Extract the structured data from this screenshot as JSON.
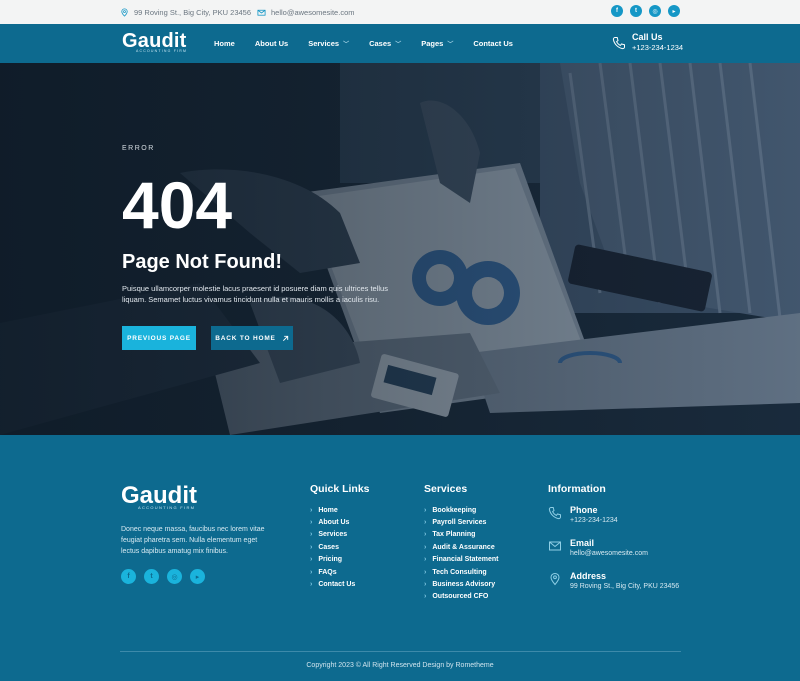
{
  "topbar": {
    "address": "99 Roving St., Big City, PKU 23456",
    "email": "hello@awesomesite.com",
    "social": [
      "facebook-icon",
      "twitter-icon",
      "instagram-icon",
      "youtube-icon"
    ]
  },
  "brand": {
    "name": "Gaudit",
    "tagline": "ACCOUNTING FIRM"
  },
  "nav": {
    "items": [
      {
        "label": "Home",
        "dropdown": false
      },
      {
        "label": "About Us",
        "dropdown": false
      },
      {
        "label": "Services",
        "dropdown": true
      },
      {
        "label": "Cases",
        "dropdown": true
      },
      {
        "label": "Pages",
        "dropdown": true
      },
      {
        "label": "Contact Us",
        "dropdown": false
      }
    ],
    "call_title": "Call Us",
    "call_number": "+123-234-1234"
  },
  "hero": {
    "eyebrow": "ERROR",
    "code": "404",
    "title": "Page Not Found!",
    "description": "Puisque ullamcorper molestie lacus praesent id posuere diam quis ultrices tellus liquam. Semamet luctus vivamus tincidunt nulla et mauris mollis a iaculis risu.",
    "btn_prev": "PREVIOUS PAGE",
    "btn_home": "BACK TO HOME"
  },
  "footer": {
    "about": "Donec neque massa, faucibus nec lorem vitae feugiat pharetra sem. Nulla elementum eget lectus dapibus amatug mix finibus.",
    "quick_links_title": "Quick Links",
    "quick_links": [
      "Home",
      "About Us",
      "Services",
      "Cases",
      "Pricing",
      "FAQs",
      "Contact Us"
    ],
    "services_title": "Services",
    "services": [
      "Bookkeeping",
      "Payroll Services",
      "Tax Planning",
      "Audit & Assurance",
      "Financial Statement",
      "Tech Consulting",
      "Business Advisory",
      "Outsourced CFO"
    ],
    "info_title": "Information",
    "phone_title": "Phone",
    "phone": "+123-234-1234",
    "email_title": "Email",
    "email": "hello@awesomesite.com",
    "address_title": "Address",
    "address": "99 Roving St., Big City, PKU 23456",
    "copyright": "Copyright 2023 © All Right Reserved Design by Rometheme"
  },
  "colors": {
    "primary": "#0d6a8f",
    "accent": "#1ab3dc",
    "topbar_bg": "#f3f4f4"
  }
}
